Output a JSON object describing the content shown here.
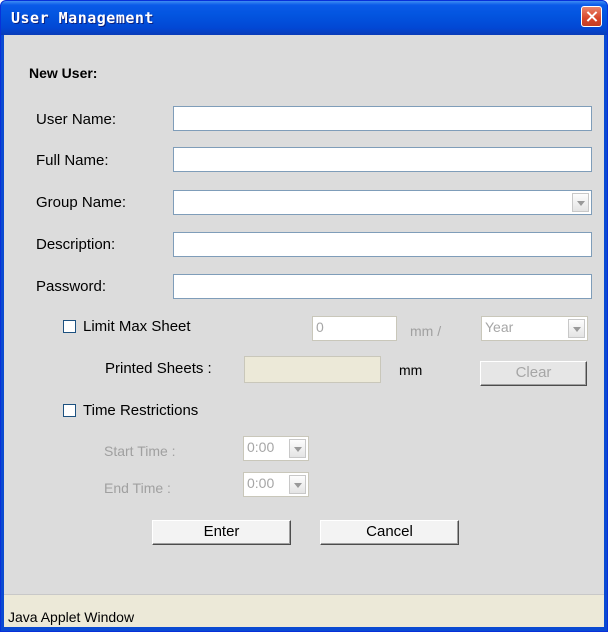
{
  "window": {
    "title": "User Management"
  },
  "form": {
    "heading": "New User:",
    "user_name": {
      "label": "User Name:",
      "value": ""
    },
    "full_name": {
      "label": "Full Name:",
      "value": ""
    },
    "group_name": {
      "label": "Group Name:",
      "value": ""
    },
    "description": {
      "label": "Description:",
      "value": ""
    },
    "password": {
      "label": "Password:",
      "value": ""
    },
    "limit_max_sheet": {
      "label": "Limit Max Sheet",
      "checked": false,
      "value": "0",
      "unit": "mm /",
      "period": "Year"
    },
    "printed_sheets": {
      "label": "Printed Sheets :",
      "value": "",
      "unit": "mm",
      "clear_label": "Clear"
    },
    "time_restrictions": {
      "label": "Time Restrictions",
      "checked": false
    },
    "start_time": {
      "label": "Start Time :",
      "value": "0:00"
    },
    "end_time": {
      "label": "End Time :",
      "value": "0:00"
    }
  },
  "buttons": {
    "enter": "Enter",
    "cancel": "Cancel"
  },
  "status": {
    "text": "Java Applet Window"
  }
}
